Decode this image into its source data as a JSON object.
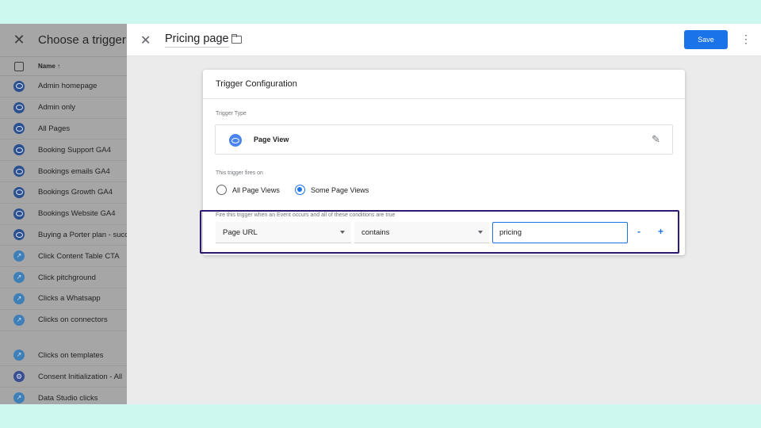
{
  "left_panel": {
    "title": "Choose a trigger",
    "column_header": "Name ↑",
    "items": [
      {
        "icon": "eye-icon",
        "name": "Admin homepage"
      },
      {
        "icon": "eye-icon",
        "name": "Admin only"
      },
      {
        "icon": "eye-icon",
        "name": "All Pages"
      },
      {
        "icon": "eye-icon",
        "name": "Booking Support GA4"
      },
      {
        "icon": "eye-icon",
        "name": "Bookings emails GA4"
      },
      {
        "icon": "eye-icon",
        "name": "Bookings Growth GA4"
      },
      {
        "icon": "eye-icon",
        "name": "Bookings Website GA4"
      },
      {
        "icon": "eye-icon",
        "name": "Buying a Porter plan - succ"
      },
      {
        "icon": "link-icon",
        "name": "Click Content Table CTA"
      },
      {
        "icon": "link-icon",
        "name": "Click pitchground"
      },
      {
        "icon": "link-icon",
        "name": "Clicks a Whatsapp"
      },
      {
        "icon": "link-icon",
        "name": "Clicks on connectors"
      },
      {
        "icon": "link-icon",
        "name": "Clicks on templates"
      },
      {
        "icon": "gear-icon",
        "name": "Consent Initialization - All"
      },
      {
        "icon": "link-icon",
        "name": "Data Studio clicks"
      }
    ]
  },
  "header": {
    "title": "Pricing page",
    "save_label": "Save"
  },
  "card": {
    "title": "Trigger Configuration",
    "trigger_type_label": "Trigger Type",
    "trigger_type": "Page View",
    "fires_on_label": "This trigger fires on",
    "options": [
      "All Page Views",
      "Some Page Views"
    ],
    "selected_option": "Some Page Views",
    "condition_label": "Fire this trigger when an Event occurs and all of these conditions are true",
    "condition": {
      "variable": "Page URL",
      "operator": "contains",
      "value": "pricing"
    },
    "minus": "-",
    "plus": "+"
  },
  "colors": {
    "accent": "#1a73e8",
    "highlight_border": "#2d1a6e",
    "outer_background": "#ccf8f0"
  }
}
